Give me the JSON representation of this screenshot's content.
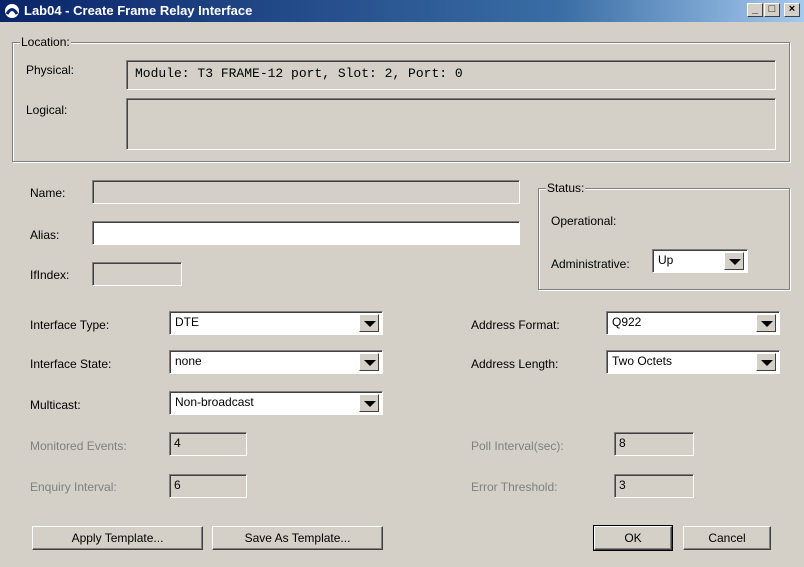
{
  "window": {
    "title": "Lab04 - Create Frame Relay Interface",
    "minimize": "_",
    "maximize": "□",
    "close": "×"
  },
  "location": {
    "group_label": "Location:",
    "physical_label": "Physical:",
    "physical_value": "Module: T3 FRAME-12 port, Slot: 2, Port: 0",
    "logical_label": "Logical:",
    "logical_value": ""
  },
  "identity": {
    "name_label": "Name:",
    "name_value": "",
    "alias_label": "Alias:",
    "alias_value": "",
    "ifindex_label": "IfIndex:",
    "ifindex_value": ""
  },
  "status": {
    "group_label": "Status:",
    "operational_label": "Operational:",
    "administrative_label": "Administrative:",
    "administrative_value": "Up"
  },
  "config": {
    "interface_type_label": "Interface Type:",
    "interface_type_value": "DTE",
    "interface_state_label": "Interface State:",
    "interface_state_value": "none",
    "multicast_label": "Multicast:",
    "multicast_value": "Non-broadcast",
    "address_format_label": "Address Format:",
    "address_format_value": "Q922",
    "address_length_label": "Address Length:",
    "address_length_value": "Two Octets",
    "monitored_events_label": "Monitored Events:",
    "monitored_events_value": "4",
    "enquiry_interval_label": "Enquiry Interval:",
    "enquiry_interval_value": "6",
    "poll_interval_label": "Poll Interval(sec):",
    "poll_interval_value": "8",
    "error_threshold_label": "Error Threshold:",
    "error_threshold_value": "3"
  },
  "buttons": {
    "apply_template": "Apply Template...",
    "save_as_template": "Save As Template...",
    "ok": "OK",
    "cancel": "Cancel"
  }
}
